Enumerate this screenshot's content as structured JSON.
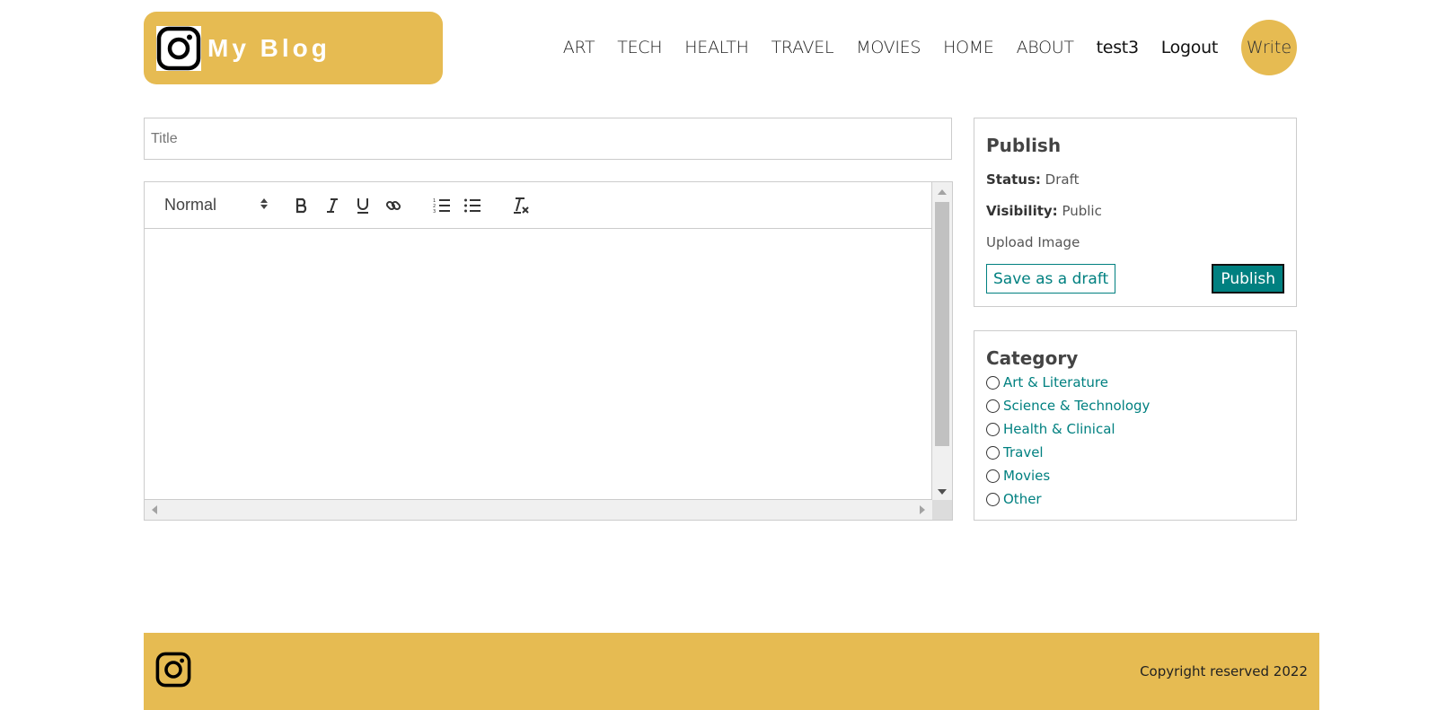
{
  "brand": {
    "name": "My Blog",
    "icon": "instagram-icon"
  },
  "nav": {
    "links": [
      "ART",
      "TECH",
      "HEALTH",
      "TRAVEL",
      "MOVIES",
      "HOME",
      "ABOUT"
    ],
    "user": "test3",
    "logout": "Logout",
    "write": "Write"
  },
  "editor": {
    "title_placeholder": "Title",
    "format_select": "Normal",
    "toolbar_icons": [
      "bold-icon",
      "italic-icon",
      "underline-icon",
      "link-icon",
      "ordered-list-icon",
      "bullet-list-icon",
      "clear-format-icon"
    ]
  },
  "publish": {
    "title": "Publish",
    "status_label": "Status:",
    "status_value": "Draft",
    "visibility_label": "Visibility:",
    "visibility_value": "Public",
    "upload": "Upload Image",
    "draft_button": "Save as a draft",
    "publish_button": "Publish"
  },
  "category": {
    "title": "Category",
    "options": [
      "Art & Literature",
      "Science & Technology",
      "Health & Clinical",
      "Travel",
      "Movies",
      "Other"
    ]
  },
  "footer": {
    "copyright": "Copyright reserved 2022",
    "icon": "instagram-icon"
  },
  "colors": {
    "brand": "#e6bb52",
    "accent": "#008080"
  }
}
